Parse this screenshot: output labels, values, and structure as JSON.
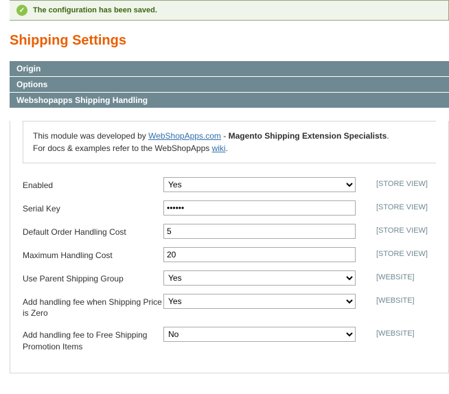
{
  "success_message": "The configuration has been saved.",
  "page_title": "Shipping Settings",
  "sections": {
    "origin": {
      "label": "Origin"
    },
    "options": {
      "label": "Options"
    },
    "wsa": {
      "label": "Webshopapps Shipping Handling"
    }
  },
  "info": {
    "prefix": "This module was developed by ",
    "link1_text": "WebShopApps.com",
    "mid": " - ",
    "bold": "Magento Shipping Extension Specialists",
    "suffix1": ".",
    "line2a": "For docs & examples refer to the WebShopApps ",
    "link2_text": "wiki",
    "suffix2": "."
  },
  "scopes": {
    "store": "[STORE VIEW]",
    "website": "[WEBSITE]"
  },
  "fields": {
    "enabled": {
      "label": "Enabled",
      "value": "Yes",
      "scope": "store"
    },
    "serial_key": {
      "label": "Serial Key",
      "value": "••••••",
      "scope": "store"
    },
    "default_handling": {
      "label": "Default Order Handling Cost",
      "value": "5",
      "scope": "store"
    },
    "max_handling": {
      "label": "Maximum Handling Cost",
      "value": "20",
      "scope": "store"
    },
    "use_parent": {
      "label": "Use Parent Shipping Group",
      "value": "Yes",
      "scope": "website"
    },
    "fee_zero": {
      "label": "Add handling fee when Shipping Price is Zero",
      "value": "Yes",
      "scope": "website"
    },
    "fee_free_promo": {
      "label": "Add handling fee to Free Shipping Promotion Items",
      "value": "No",
      "scope": "website"
    }
  },
  "options": {
    "yesno": [
      "Yes",
      "No"
    ]
  }
}
